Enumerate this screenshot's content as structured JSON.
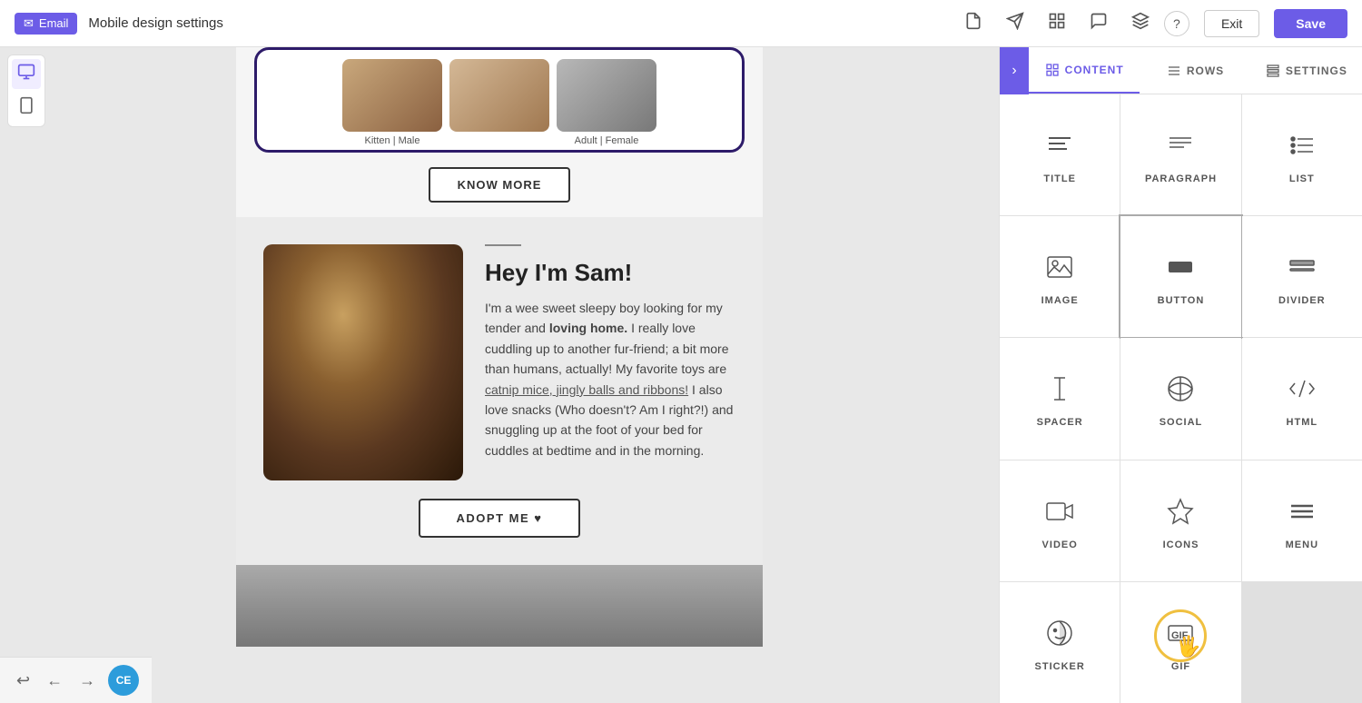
{
  "topbar": {
    "email_badge": "Email",
    "title": "Mobile design settings",
    "help_label": "?",
    "exit_label": "Exit",
    "save_label": "Save",
    "icons": [
      "document",
      "send",
      "grid",
      "chat",
      "layers"
    ]
  },
  "device_bar": {
    "desktop_icon": "🖥",
    "mobile_icon": "📱"
  },
  "canvas": {
    "cat_cards": [
      {
        "label": "Kitten | Male"
      },
      {
        "label": ""
      },
      {
        "label": "Adult | Female"
      }
    ],
    "know_more_btn": "KNOW MORE",
    "sam_section": {
      "title": "Hey I'm Sam!",
      "body_line1": "I'm a wee sweet sleepy boy looking for my tender and ",
      "body_bold": "loving home.",
      "body_line2": " I really love cuddling up to another fur-friend; a bit more than humans, actually! My favorite toys are ",
      "body_link": "catnip mice, jingly balls and ribbons!",
      "body_line3": " I also love snacks (Who doesn't? Am I right?!) and snuggling up at the foot of your bed for cuddles at bedtime and in the morning.",
      "adopt_btn": "ADOPT ME ♥"
    }
  },
  "right_panel": {
    "toggle_icon": "›",
    "tabs": [
      {
        "id": "content",
        "label": "CONTENT",
        "icon": "grid"
      },
      {
        "id": "rows",
        "label": "ROWS",
        "icon": "rows"
      },
      {
        "id": "settings",
        "label": "SETTINGS",
        "icon": "settings"
      }
    ],
    "active_tab": "content",
    "content_items": [
      {
        "id": "title",
        "label": "TITLE",
        "icon": "title"
      },
      {
        "id": "paragraph",
        "label": "PARAGRAPH",
        "icon": "paragraph"
      },
      {
        "id": "list",
        "label": "LIST",
        "icon": "list"
      },
      {
        "id": "image",
        "label": "IMAGE",
        "icon": "image"
      },
      {
        "id": "button",
        "label": "BUTTON",
        "icon": "button"
      },
      {
        "id": "divider",
        "label": "DIVIDER",
        "icon": "divider"
      },
      {
        "id": "spacer",
        "label": "SPACER",
        "icon": "spacer"
      },
      {
        "id": "social",
        "label": "SOCIAL",
        "icon": "social"
      },
      {
        "id": "html",
        "label": "HTML",
        "icon": "html"
      },
      {
        "id": "video",
        "label": "VIDEO",
        "icon": "video"
      },
      {
        "id": "icons",
        "label": "ICONS",
        "icon": "icons"
      },
      {
        "id": "menu",
        "label": "MENU",
        "icon": "menu"
      },
      {
        "id": "sticker",
        "label": "STICKER",
        "icon": "sticker"
      },
      {
        "id": "gif",
        "label": "GIF",
        "icon": "gif"
      }
    ]
  },
  "bottom_toolbar": {
    "undo_icon": "↩",
    "back_icon": "←",
    "forward_icon": "→",
    "avatar_label": "CE"
  }
}
